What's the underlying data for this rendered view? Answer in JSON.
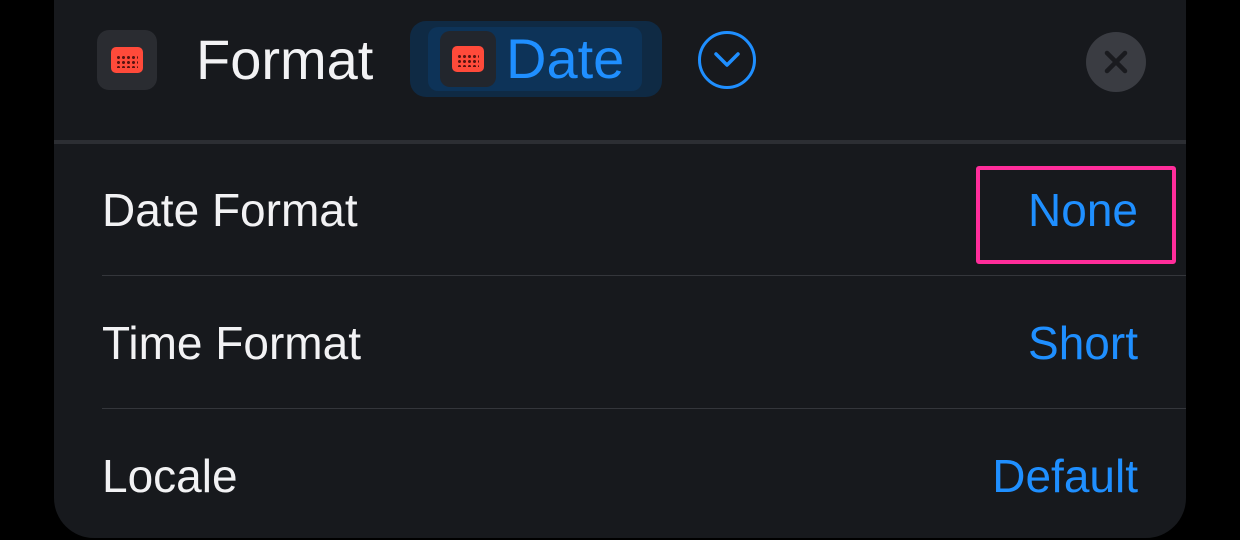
{
  "header": {
    "title": "Format",
    "variable": "Date",
    "app_icon": "calendar-icon",
    "expand_icon": "chevron-down-circle-icon",
    "close_icon": "close-icon"
  },
  "rows": [
    {
      "label": "Date Format",
      "value": "None"
    },
    {
      "label": "Time Format",
      "value": "Short"
    },
    {
      "label": "Locale",
      "value": "Default"
    }
  ],
  "colors": {
    "accent": "#1f8fff",
    "highlight": "#ff2d9a",
    "background": "#17191d"
  }
}
